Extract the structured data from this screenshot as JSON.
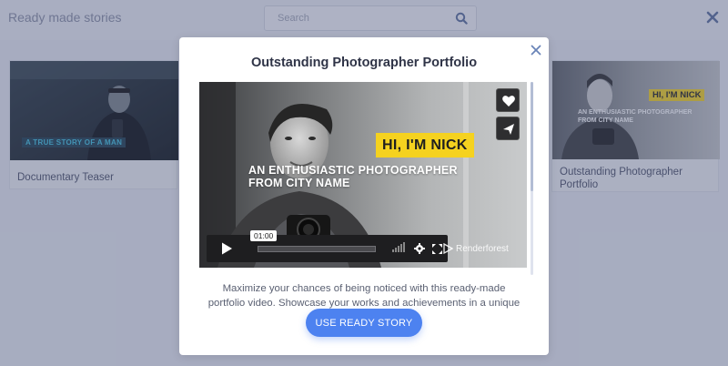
{
  "header": {
    "title": "Ready made stories",
    "search_placeholder": "Search",
    "search_icon": "search-icon",
    "close_icon": "close-icon"
  },
  "cards": [
    {
      "title": "Documentary Teaser",
      "thumb_caption": "A TRUE STORY OF A MAN"
    },
    {
      "title": "Outstanding Photographer Portfolio",
      "thumb_tag": "HI, I'M NICK",
      "thumb_subtitle": "AN ENTHUSIASTIC PHOTOGRAPHER FROM CITY NAME"
    }
  ],
  "modal": {
    "title": "Outstanding Photographer Portfolio",
    "video": {
      "tag": "HI, I'M NICK",
      "subtitle_line1": "AN ENTHUSIASTIC PHOTOGRAPHER",
      "subtitle_line2": "FROM CITY NAME",
      "time": "01:00",
      "brand": "Renderforest",
      "icons": [
        "heart-icon",
        "send-icon",
        "play-icon",
        "volume-icon",
        "gear-icon",
        "fullscreen-icon"
      ]
    },
    "description": "Maximize your chances of being noticed with this ready-made portfolio video. Showcase your works and achievements in a unique",
    "cta_label": "USE READY STORY",
    "accent_color": "#4d82f0",
    "tag_color": "#f5d21f"
  }
}
